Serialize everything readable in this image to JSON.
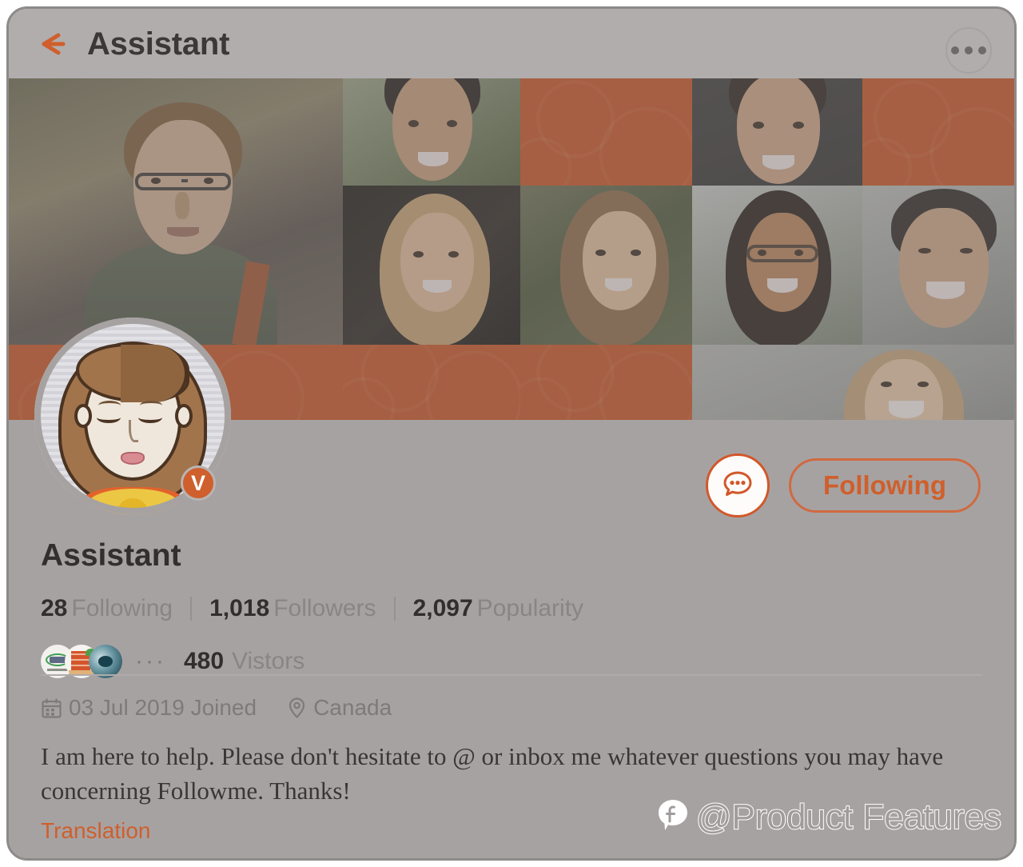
{
  "header": {
    "title": "Assistant",
    "back_icon": "arrow-left-icon",
    "more_icon": "more-horizontal-icon"
  },
  "banner": {
    "accent_color": "#c9511f",
    "tiles": [
      {
        "name": "photo-man-glasses",
        "type": "photo"
      },
      {
        "name": "photo-young-man-smiling",
        "type": "photo"
      },
      {
        "name": "accent-tile-1",
        "type": "accent"
      },
      {
        "name": "photo-man-dark-bg",
        "type": "photo"
      },
      {
        "name": "accent-tile-2",
        "type": "accent"
      },
      {
        "name": "photo-blonde-woman",
        "type": "photo"
      },
      {
        "name": "photo-brunette-woman-outdoor",
        "type": "photo"
      },
      {
        "name": "photo-woman-glasses",
        "type": "photo"
      },
      {
        "name": "photo-asian-man",
        "type": "photo"
      },
      {
        "name": "accent-tile-3",
        "type": "accent"
      },
      {
        "name": "accent-tile-4",
        "type": "accent"
      },
      {
        "name": "accent-tile-5",
        "type": "accent"
      },
      {
        "name": "photo-blonde-woman-laughing",
        "type": "photo"
      }
    ]
  },
  "profile": {
    "avatar_alt": "cartoon-woman-avatar",
    "verified_badge": "V",
    "display_name": "Assistant",
    "message_icon": "message-bubble-icon",
    "follow_label": "Following",
    "accent_color": "#cf5f2c",
    "stats": [
      {
        "value": "28",
        "label": "Following"
      },
      {
        "value": "1,018",
        "label": "Followers"
      },
      {
        "value": "2,097",
        "label": "Popularity"
      }
    ],
    "visitors": {
      "overflow": "···",
      "count": "480",
      "label": "Vistors",
      "avatars": [
        "visitor-avatar-green-logo",
        "visitor-avatar-orange-grid",
        "visitor-avatar-teal-photo"
      ]
    },
    "meta": {
      "calendar_icon": "calendar-icon",
      "joined": "03 Jul 2019 Joined",
      "location_icon": "location-pin-icon",
      "location": "Canada"
    },
    "bio": "I am here to help. Please don't hesitate to @ or inbox me whatever questions you may have concerning Followme. Thanks!",
    "translation_label": "Translation"
  },
  "watermark": {
    "logo_icon": "followme-bubble-logo-icon",
    "text": "@Product Features"
  }
}
